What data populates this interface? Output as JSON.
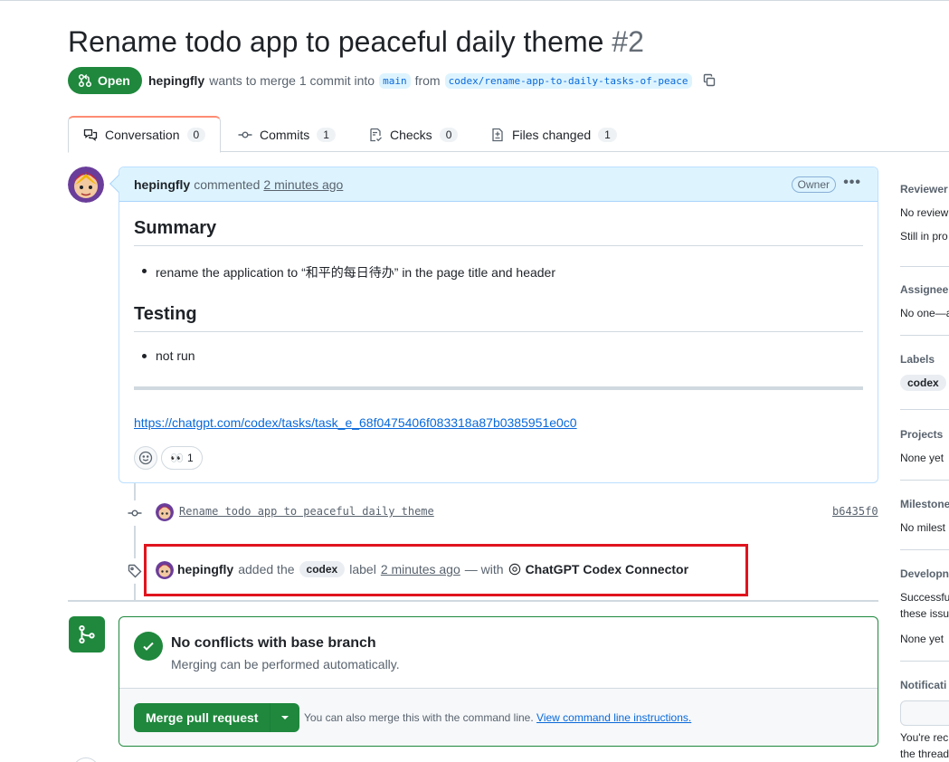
{
  "pr": {
    "title": "Rename todo app to peaceful daily theme",
    "number": "#2",
    "state": "Open",
    "author": "hepingfly",
    "meta_text": "wants to merge 1 commit into",
    "base_branch": "main",
    "from_text": "from",
    "head_branch": "codex/rename-app-to-daily-tasks-of-peace"
  },
  "tabs": [
    {
      "label": "Conversation",
      "count": "0",
      "icon": "comment-discussion-icon"
    },
    {
      "label": "Commits",
      "count": "1",
      "icon": "git-commit-icon"
    },
    {
      "label": "Checks",
      "count": "0",
      "icon": "checklist-icon"
    },
    {
      "label": "Files changed",
      "count": "1",
      "icon": "file-diff-icon"
    }
  ],
  "comment": {
    "author": "hepingfly",
    "action": "commented",
    "time": "2 minutes ago",
    "badge": "Owner",
    "summary_heading": "Summary",
    "summary_item": "rename the application to “和平的每日待办” in the page title and header",
    "testing_heading": "Testing",
    "testing_item": "not run",
    "link": "https://chatgpt.com/codex/tasks/task_e_68f0475406f083318a87b0385951e0c0",
    "reaction_emoji": "👀",
    "reaction_count": "1"
  },
  "commit": {
    "message": "Rename todo app to peaceful daily theme",
    "sha": "b6435f0"
  },
  "label_event": {
    "author": "hepingfly",
    "text1": "added the",
    "label": "codex",
    "text2": "label",
    "time": "2 minutes ago",
    "text3": "— with",
    "app": "ChatGPT Codex Connector"
  },
  "merge": {
    "title": "No conflicts with base branch",
    "subtitle": "Merging can be performed automatically.",
    "button": "Merge pull request",
    "hint": "You can also merge this with the command line.",
    "hint_link": "View command line instructions."
  },
  "sidebar": {
    "reviewers_h": "Reviewer",
    "reviewers_t1": "No review",
    "reviewers_t2": "Still in pro",
    "assignees_h": "Assignee",
    "assignees_t": "No one—a",
    "labels_h": "Labels",
    "labels_pill": "codex",
    "projects_h": "Projects",
    "projects_t": "None yet",
    "milestone_h": "Milestone",
    "milestone_t": "No milest",
    "development_h": "Developn",
    "development_t1": "Successfu",
    "development_t2": "these issu",
    "development_t3": "None yet",
    "notifications_h": "Notificati",
    "notifications_t1": "You're rec",
    "notifications_t2": "the thread"
  },
  "colors": {
    "open_green": "#1f883d",
    "link_blue": "#0969da",
    "highlight_red": "#e0141e"
  }
}
